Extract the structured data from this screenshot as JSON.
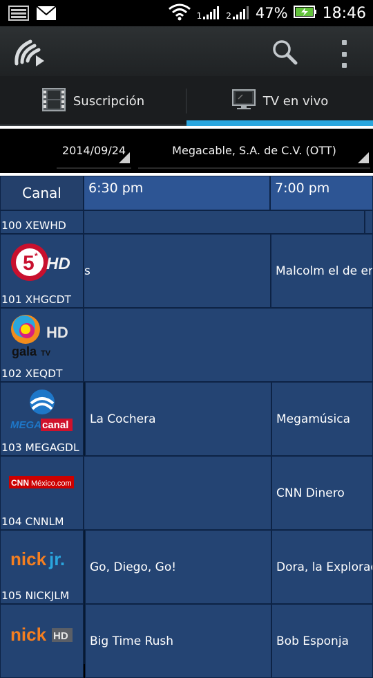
{
  "status_bar": {
    "battery": "47%",
    "time": "18:46",
    "sim1": "1",
    "sim2": "2"
  },
  "tabs": [
    {
      "label": "Suscripción",
      "icon": "film-icon"
    },
    {
      "label": "TV en vivo",
      "icon": "tv-icon"
    }
  ],
  "filters": {
    "date": "2014/09/24",
    "provider": "Megacable, S.A. de C.V. (OTT)"
  },
  "guide": {
    "header_channel": "Canal",
    "times": [
      "6:30 pm",
      "7:00 pm"
    ],
    "channels": [
      {
        "code": "100 XEWHD",
        "logo": "",
        "programs": [
          "",
          ""
        ]
      },
      {
        "code": "101 XHGCDT",
        "logo": "5* HD",
        "programs": [
          "s",
          "Malcolm el de en"
        ]
      },
      {
        "code": "102 XEQDT",
        "logo": "gala TV HD",
        "programs": [
          ""
        ]
      },
      {
        "code": "103 MEGAGDL",
        "logo": "MEGAcanal",
        "programs": [
          "La Cochera",
          "Megamúsica"
        ]
      },
      {
        "code": "104 CNNLM",
        "logo": "CNN México.com",
        "programs": [
          "",
          "CNN Dinero"
        ]
      },
      {
        "code": "105 NICKJLM",
        "logo": "nick jr.",
        "programs": [
          "Go, Diego, Go!",
          "Dora, la Explorado"
        ]
      },
      {
        "code": "",
        "logo": "nick HD",
        "programs": [
          "Big Time Rush",
          "Bob Esponja"
        ]
      }
    ]
  },
  "colors": {
    "accent": "#2aa6de",
    "cell": "#244473",
    "header_time": "#2d5594"
  }
}
